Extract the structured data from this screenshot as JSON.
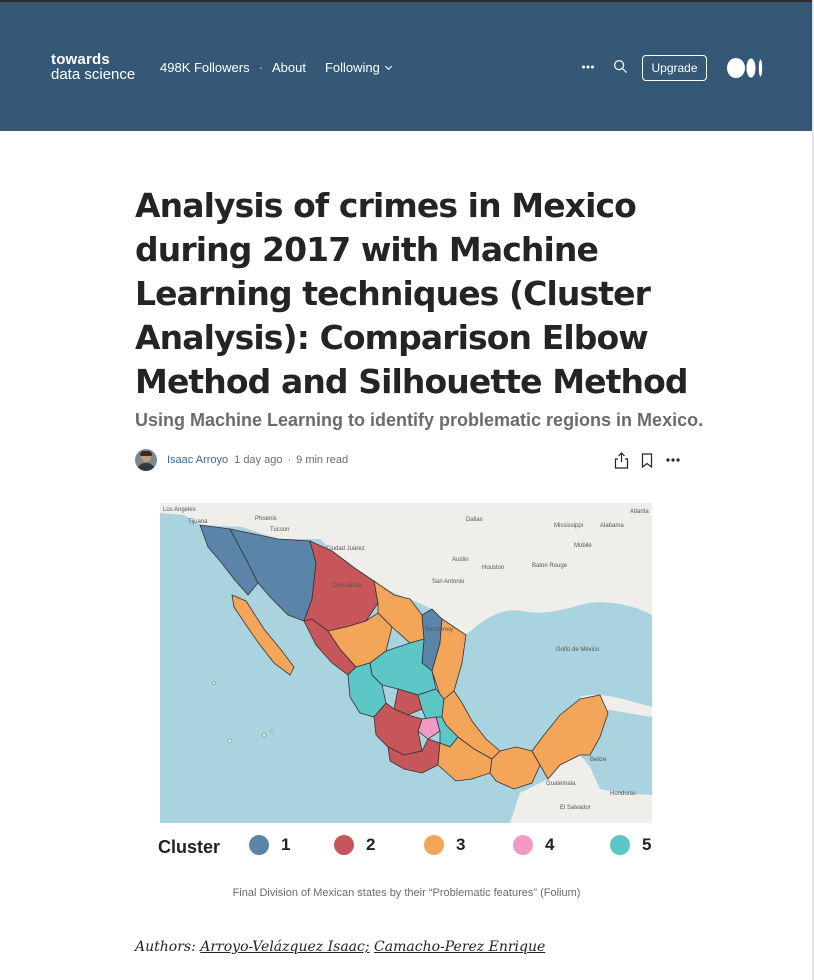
{
  "header": {
    "brand_line1": "towards",
    "brand_line2": "data science",
    "followers": "498K Followers",
    "separator": "·",
    "about": "About",
    "following": "Following",
    "upgrade": "Upgrade",
    "bg_color": "#355876"
  },
  "article": {
    "title": "Analysis of crimes in Mexico during 2017 with Machine Learning techniques (Cluster Analysis): Comparison Elbow Method and Silhouette Method",
    "subtitle": "Using Machine Learning to identify problematic regions in Mexico.",
    "author": "Isaac Arroyo",
    "time_ago": "1 day ago",
    "meta_sep": "·",
    "read_time": "9 min read"
  },
  "figure": {
    "map_labels": [
      "Los Angeles",
      "Phoenix",
      "Tucson",
      "Dallas",
      "Austin",
      "Houston",
      "San Antonio",
      "Baton Rouge",
      "Mobile",
      "Alabama",
      "Atlanta",
      "Mississippi",
      "Ciudad Juárez",
      "Chihuahua",
      "Monterrey",
      "Golfo de México",
      "Guatemala",
      "Belize",
      "Honduras",
      "El Salvador",
      "Tijuana"
    ],
    "legend_title": "Cluster",
    "legend": [
      {
        "label": "1",
        "color": "#5b85a8"
      },
      {
        "label": "2",
        "color": "#c6565a"
      },
      {
        "label": "3",
        "color": "#f3a65a"
      },
      {
        "label": "4",
        "color": "#f29ac6"
      },
      {
        "label": "5",
        "color": "#5dc6c6"
      }
    ],
    "caption": "Final Division of Mexican states by their “Problematic features” (Folium)"
  },
  "authors": {
    "prefix": "Authors: ",
    "author1": "Arroyo-Velázquez Isaac;",
    "author2": "Camacho-Perez Enrique"
  }
}
